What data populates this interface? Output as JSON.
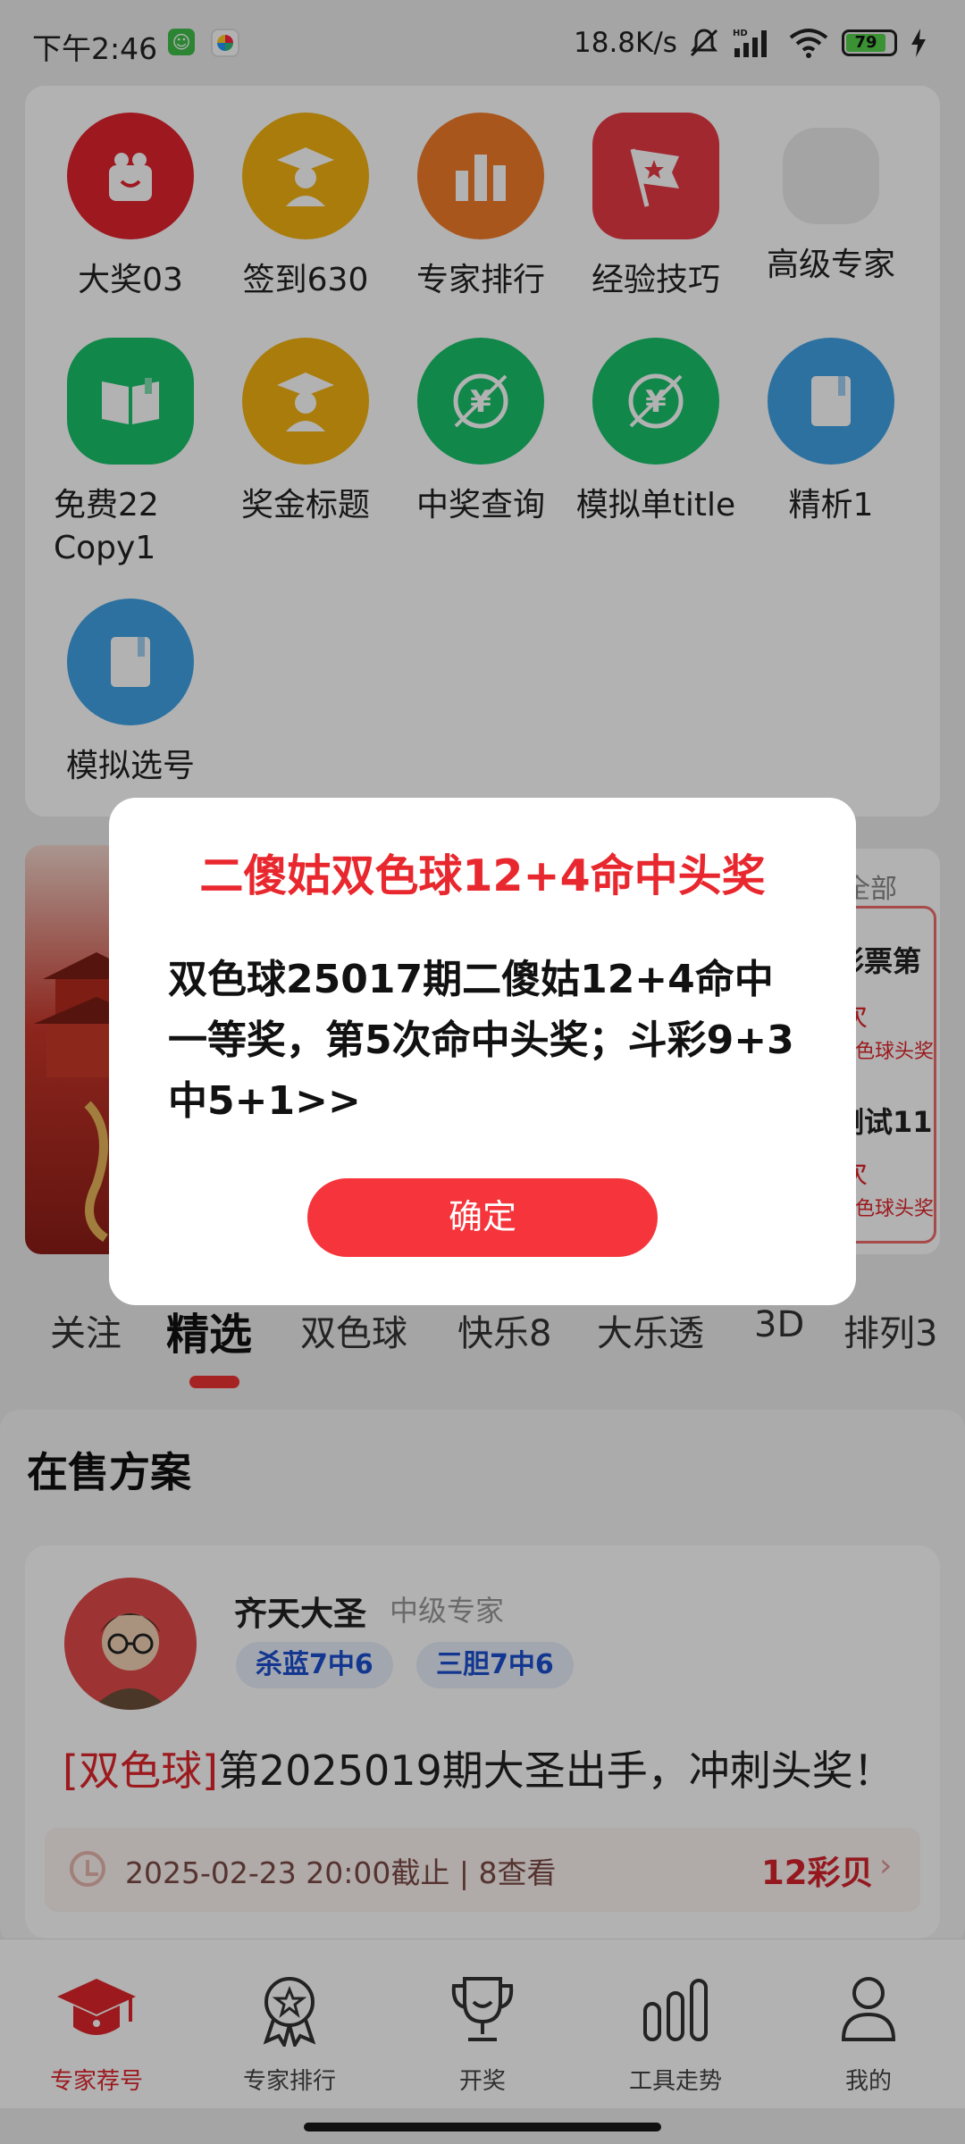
{
  "status_bar": {
    "time": "下午2:46",
    "net_speed": "18.8K/s",
    "battery": "79"
  },
  "grid": {
    "items": [
      {
        "label": "大奖03",
        "icon": "gift-icon",
        "color": "#e3232e"
      },
      {
        "label": "签到630",
        "icon": "graduate-icon",
        "color": "#f2b211"
      },
      {
        "label": "专家排行",
        "icon": "bar-chart-icon",
        "color": "#f27c2a"
      },
      {
        "label": "经验技巧",
        "icon": "flag-icon",
        "color": "#e83a45"
      },
      {
        "label": "高级专家",
        "icon": "placeholder-icon",
        "color": "#e7e7e7"
      },
      {
        "label": "免费22\nCopy1",
        "icon": "book-icon",
        "color": "#19c26b"
      },
      {
        "label": "奖金标题",
        "icon": "graduate-icon",
        "color": "#f2b211"
      },
      {
        "label": "中奖查询",
        "icon": "coin-icon",
        "color": "#19c26b"
      },
      {
        "label": "模拟单title",
        "icon": "coin-icon",
        "color": "#19c26b"
      },
      {
        "label": "精析1",
        "icon": "notebook-icon",
        "color": "#3fa2e6"
      },
      {
        "label": "模拟选号",
        "icon": "notebook-icon",
        "color": "#3fa2e6"
      }
    ]
  },
  "side": {
    "all_label": "全部",
    "items": [
      {
        "title": "彩票第",
        "count_suffix": "次",
        "tag": "双色球头奖"
      },
      {
        "title": "测试11",
        "count_suffix": "次",
        "tag": "双色球头奖"
      }
    ]
  },
  "tabs": [
    {
      "label": "关注"
    },
    {
      "label": "精选",
      "active": true
    },
    {
      "label": "双色球"
    },
    {
      "label": "快乐8"
    },
    {
      "label": "大乐透"
    },
    {
      "label": "3D"
    },
    {
      "label": "排列3"
    }
  ],
  "section": {
    "title": "在售方案"
  },
  "plan": {
    "expert_name": "齐天大圣",
    "expert_level": "中级专家",
    "tags": [
      "杀蓝7中6",
      "三胆7中6"
    ],
    "category": "[双色球]",
    "title": "第2025019期大圣出手，冲刺头奖！",
    "meta": "2025-02-23 20:00截止 | 8查看",
    "price": "12彩贝"
  },
  "bottom_nav": [
    {
      "label": "专家荐号",
      "icon": "graduation-cap-icon",
      "active": true
    },
    {
      "label": "专家排行",
      "icon": "medal-icon"
    },
    {
      "label": "开奖",
      "icon": "trophy-icon"
    },
    {
      "label": "工具走势",
      "icon": "trend-bars-icon"
    },
    {
      "label": "我的",
      "icon": "user-icon"
    }
  ],
  "modal": {
    "title": "二傻姑双色球12+4命中头奖",
    "body": "双色球25017期二傻姑12+4命中一等奖，第5次命中头奖；斗彩9+3中5+1>>",
    "confirm": "确定"
  },
  "colors": {
    "accent": "#f5353b",
    "tag_blue": "#1c4fcf",
    "price_red": "#d4232b"
  }
}
